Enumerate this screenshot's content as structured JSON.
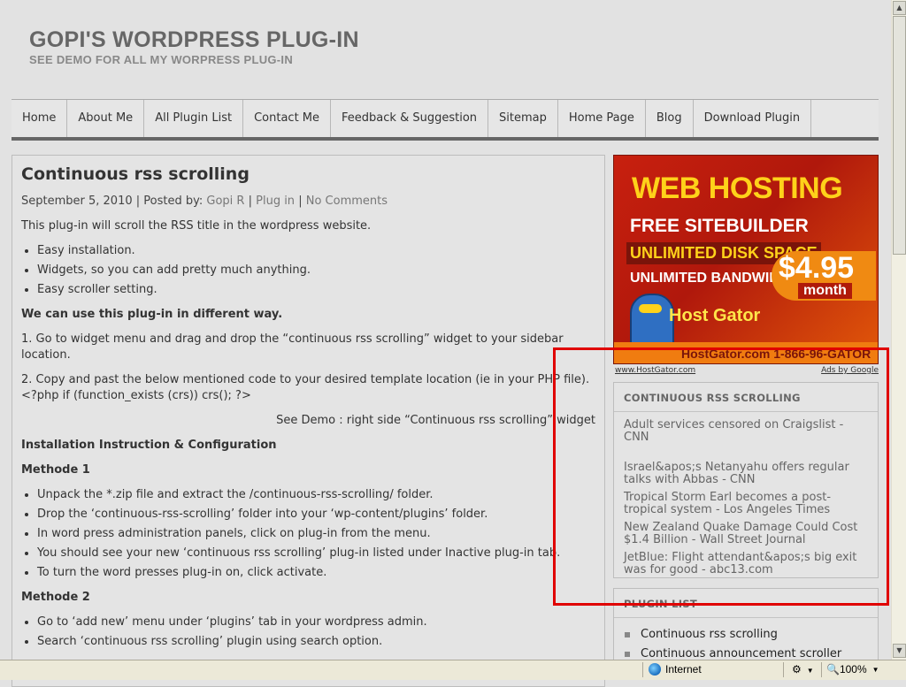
{
  "site": {
    "title": "GOPI'S WORDPRESS PLUG-IN",
    "tagline": "SEE DEMO FOR ALL MY WORPRESS PLUG-IN"
  },
  "nav": [
    "Home",
    "About Me",
    "All Plugin List",
    "Contact Me",
    "Feedback & Suggestion",
    "Sitemap",
    "Home Page",
    "Blog",
    "Download Plugin"
  ],
  "post": {
    "title": "Continuous rss scrolling",
    "date": "September 5, 2010",
    "posted_by_label": "Posted by:",
    "author": "Gopi R",
    "category": "Plug in",
    "comments": "No Comments",
    "sep": "|",
    "intro": "This plug-in will scroll the RSS title in the wordpress website.",
    "features": [
      "Easy installation.",
      "Widgets, so you can add pretty much anything.",
      "Easy scroller setting."
    ],
    "ways_heading": "We can use this plug-in in different way.",
    "way1": "1. Go to widget menu and drag and drop the “continuous rss scrolling” widget to your sidebar location.",
    "way2": "2. Copy and past the below mentioned code to your desired template location (ie in your PHP file).",
    "code": "<?php if (function_exists (crs)) crs(); ?>",
    "demo_note": "See Demo : right side “Continuous rss scrolling” widget",
    "install_heading": "Installation Instruction & Configuration",
    "method1_heading": "Methode 1",
    "method1_steps": [
      "Unpack the *.zip file and extract the /continuous-rss-scrolling/ folder.",
      "Drop the ‘continuous-rss-scrolling’ folder into your ‘wp-content/plugins’ folder.",
      "In word press administration panels, click on plug-in from the menu.",
      "You should see your new ‘continuous rss scrolling’ plug-in listed under Inactive plug-in tab.",
      "To turn the word presses plug-in on, click activate."
    ],
    "method2_heading": "Methode 2",
    "method2_steps": [
      "Go to ‘add new’ menu under ‘plugins’ tab in your wordpress admin.",
      "Search ‘continuous rss scrolling’ plugin using search option."
    ]
  },
  "ad": {
    "headline": "WEB HOSTING",
    "line1": "FREE SITEBUILDER",
    "line2": "UNLIMITED DISK SPACE",
    "line3": "UNLIMITED BANDWIDTH",
    "price": "$4.95",
    "price_unit": "month",
    "brand": "Host Gator",
    "footer": "HostGator.com 1-866-96-GATOR",
    "link": "www.HostGator.com",
    "ads_by": "Ads by Google"
  },
  "rss_widget": {
    "title": "CONTINUOUS RSS SCROLLING",
    "items": [
      "Adult services censored on Craigslist - CNN",
      "Israel&apos;s Netanyahu offers regular talks with Abbas - CNN",
      "Tropical Storm Earl becomes a post-tropical system - Los Angeles Times",
      "New Zealand Quake Damage Could Cost $1.4 Billion - Wall Street Journal",
      "JetBlue: Flight attendant&apos;s big exit was for good - abc13.com"
    ]
  },
  "plugin_widget": {
    "title": "PLUGIN LIST",
    "items": [
      "Continuous rss scrolling",
      "Continuous announcement scroller"
    ]
  },
  "statusbar": {
    "zone": "Internet",
    "zoom": "100%"
  },
  "colors": {
    "page_bg": "#e2e2e2",
    "highlight": "#e00000",
    "ad_orange": "#f07c10",
    "ad_red": "#c8200e"
  }
}
